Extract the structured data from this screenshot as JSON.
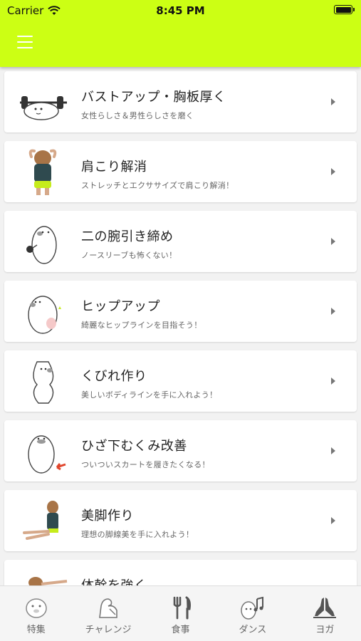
{
  "status_bar": {
    "carrier": "Carrier",
    "time": "8:45 PM"
  },
  "colors": {
    "header": "#ccff14",
    "background": "#f2f2f2",
    "card": "#ffffff"
  },
  "header": {
    "menu_icon": "hamburger-menu-icon"
  },
  "items": [
    {
      "title": "バストアップ・胸板厚く",
      "subtitle": "女性らしさ＆男性らしさを磨く",
      "illustration": "seal-lifting-barbell"
    },
    {
      "title": "肩こり解消",
      "subtitle": "ストレッチとエクササイズで肩こり解消！",
      "illustration": "girl-stretching-back"
    },
    {
      "title": "二の腕引き締め",
      "subtitle": "ノースリーブも怖くない！",
      "illustration": "seal-with-dumbbell"
    },
    {
      "title": "ヒップアップ",
      "subtitle": "綺麗なヒップラインを目指そう！",
      "illustration": "seal-hip"
    },
    {
      "title": "くびれ作り",
      "subtitle": "美しいボディラインを手に入れよう！",
      "illustration": "seal-waist"
    },
    {
      "title": "ひざ下むくみ改善",
      "subtitle": "ついついスカートを履きたくなる！",
      "illustration": "seal-legs-arrow"
    },
    {
      "title": "美脚作り",
      "subtitle": "理想の脚線美を手に入れよう！",
      "illustration": "girl-sitting-legs"
    },
    {
      "title": "体幹を強く",
      "subtitle": "",
      "illustration": "girl-plank"
    }
  ],
  "tabs": [
    {
      "label": "特集",
      "icon": "seal-face-icon"
    },
    {
      "label": "チャレンジ",
      "icon": "flexing-arm-icon"
    },
    {
      "label": "食事",
      "icon": "fork-knife-icon"
    },
    {
      "label": "ダンス",
      "icon": "dancing-music-icon"
    },
    {
      "label": "ヨガ",
      "icon": "praying-hands-icon"
    }
  ]
}
